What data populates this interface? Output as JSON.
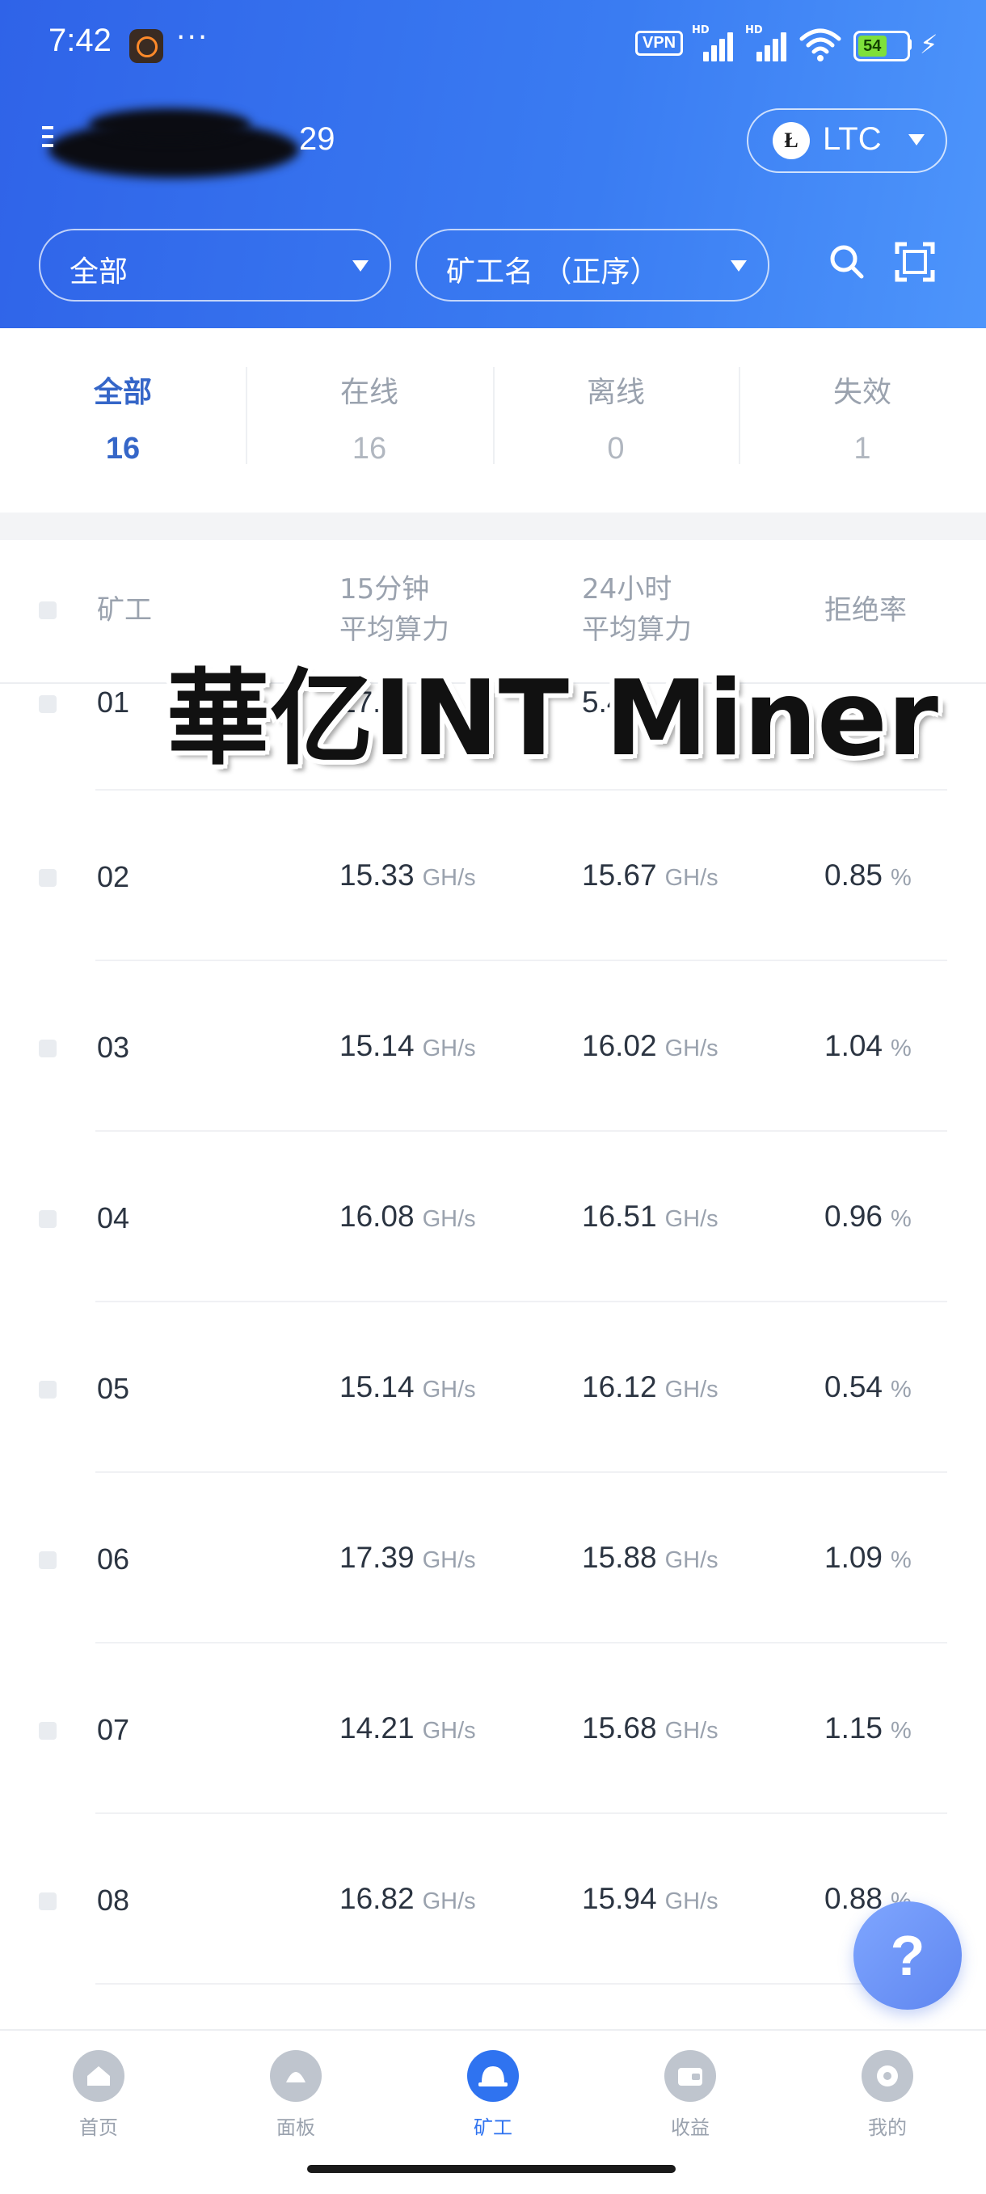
{
  "status_bar": {
    "time": "7:42",
    "more": "···",
    "vpn": "VPN",
    "signal_tag": "HD",
    "battery": "54",
    "charging": "⚡"
  },
  "header": {
    "account_suffix": "29",
    "coin": "LTC",
    "coin_logo": "Ł",
    "filter_status": "全部",
    "sort_order": "矿工名 （正序）",
    "search_icon": "search-icon",
    "scan_icon": "scan-icon"
  },
  "summary": [
    {
      "label": "全部",
      "count": "16"
    },
    {
      "label": "在线",
      "count": "16"
    },
    {
      "label": "离线",
      "count": "0"
    },
    {
      "label": "失效",
      "count": "1"
    }
  ],
  "table": {
    "headers": {
      "worker": "矿工",
      "h15_line1": "15分钟",
      "h15_line2": "平均算力",
      "h24_line1": "24小时",
      "h24_line2": "平均算力",
      "reject": "拒绝率"
    },
    "first_row_visible": {
      "name": "01",
      "h15_partial": "17.5",
      "h24_partial": "5.42"
    },
    "rows": [
      {
        "name": "02",
        "h15": "15.33",
        "h24": "15.67",
        "reject": "0.85"
      },
      {
        "name": "03",
        "h15": "15.14",
        "h24": "16.02",
        "reject": "1.04"
      },
      {
        "name": "04",
        "h15": "16.08",
        "h24": "16.51",
        "reject": "0.96"
      },
      {
        "name": "05",
        "h15": "15.14",
        "h24": "16.12",
        "reject": "0.54"
      },
      {
        "name": "06",
        "h15": "17.39",
        "h24": "15.88",
        "reject": "1.09"
      },
      {
        "name": "07",
        "h15": "14.21",
        "h24": "15.68",
        "reject": "1.15"
      },
      {
        "name": "08",
        "h15": "16.82",
        "h24": "15.94",
        "reject": "0.88"
      }
    ],
    "hash_unit": "GH/s",
    "percent_unit": "%"
  },
  "overlay_banner": "華亿INT Miner",
  "help_button": "?",
  "bottom_nav": [
    {
      "label": "首页",
      "icon": "home-icon"
    },
    {
      "label": "面板",
      "icon": "dashboard-icon"
    },
    {
      "label": "矿工",
      "icon": "miner-helmet-icon"
    },
    {
      "label": "收益",
      "icon": "wallet-icon"
    },
    {
      "label": "我的",
      "icon": "settings-icon"
    }
  ],
  "colors": {
    "header_blue": "#2f63e8",
    "accent_blue": "#3566c8",
    "nav_active": "#2f73f0"
  }
}
